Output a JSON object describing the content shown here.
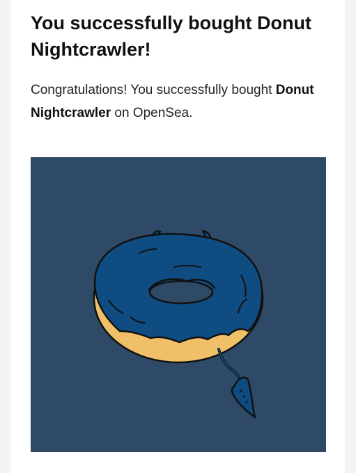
{
  "page": {
    "headline": "You successfully bought Donut Nightcrawler!",
    "message_prefix": "Congratulations! You successfully bought",
    "item_name": "Donut Nightcrawler",
    "message_suffix": "on OpenSea."
  },
  "nft_image": {
    "icon": "donut-nightcrawler-illustration",
    "colors": {
      "background": "#2e4a66",
      "frosting": "#0f4c81",
      "dough": "#efc068",
      "outline": "#111111"
    }
  }
}
